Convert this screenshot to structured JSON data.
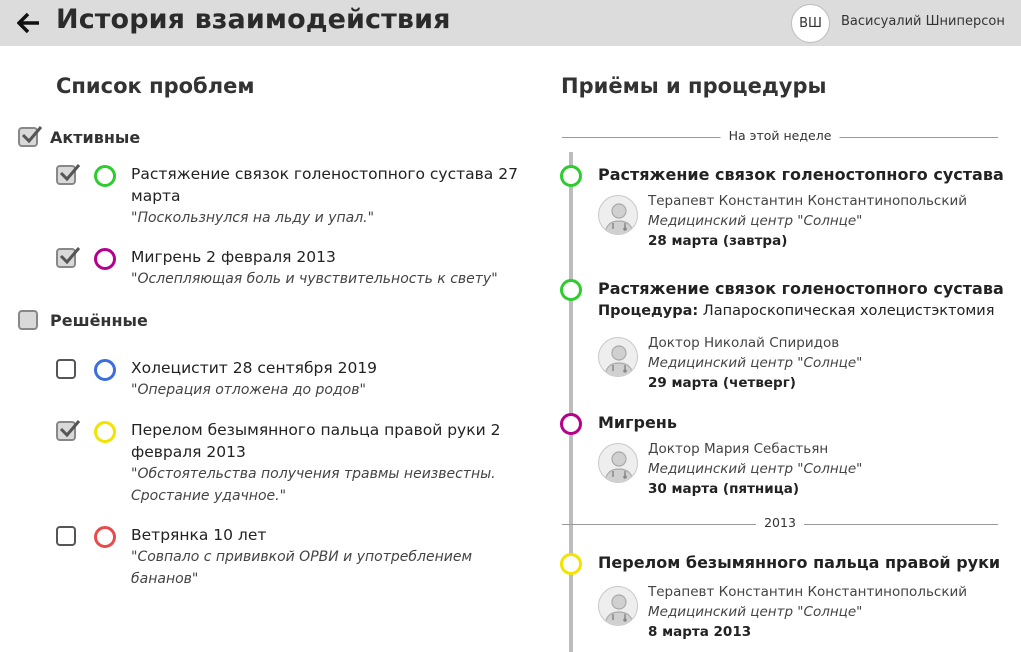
{
  "header": {
    "title": "История взаимодействия",
    "user_initials": "ВШ",
    "user_name": "Васисуалий Шниперсон"
  },
  "colors": {
    "header_bg": "#dcdcdc",
    "green": "#2ecc2e",
    "magenta": "#b5008c",
    "blue": "#3b6fe0",
    "yellow": "#f2e400",
    "red": "#e84b4b",
    "timeline": "#bdbdbd"
  },
  "problems": {
    "title": "Список проблем",
    "active": {
      "label": "Активные",
      "checked": true,
      "items": [
        {
          "name": "Растяжение связок голеностопного сустава 27 марта",
          "note": "\"Поскользнулся на льду и упал.\"",
          "checked": true,
          "color": "green"
        },
        {
          "name": "Мигрень 2 февраля 2013",
          "note": "\"Ослепляющая боль и чувствительность к свету\"",
          "checked": true,
          "color": "magenta"
        }
      ]
    },
    "resolved": {
      "label": "Решённые",
      "checked": false,
      "items": [
        {
          "name": "Холецистит 28 сентября 2019",
          "note": "\"Операция отложена до родов\"",
          "checked": false,
          "color": "blue"
        },
        {
          "name": "Перелом безымянного пальца правой руки 2 февраля 2013",
          "note": "\"Обстоятельства получения травмы неизвестны. Сростание удачное.\"",
          "checked": true,
          "color": "yellow"
        },
        {
          "name": "Ветрянка 10 лет",
          "note": "\"Совпало с прививкой ОРВИ и употреблением бананов\"",
          "checked": false,
          "color": "red"
        }
      ]
    }
  },
  "procedures": {
    "title": "Приёмы и процедуры",
    "separators": [
      "На этой неделе",
      "2013"
    ],
    "items": [
      {
        "title": "Растяжение связок голеностопного сустава",
        "color": "green",
        "procedure_label": "",
        "procedure_value": "",
        "doctor": "Терапевт Константин Константинопольский",
        "clinic": "Медицинский центр \"Солнце\"",
        "date": "28 марта (завтра)"
      },
      {
        "title": "Растяжение связок голеностопного сустава",
        "color": "green",
        "procedure_label": "Процедура:",
        "procedure_value": "Лапароскопическая холецистэктомия",
        "doctor": "Доктор Николай Спиридов",
        "clinic": "Медицинский центр \"Солнце\"",
        "date": "29 марта (четверг)"
      },
      {
        "title": "Мигрень",
        "color": "magenta",
        "procedure_label": "",
        "procedure_value": "",
        "doctor": "Доктор Мария Себастьян",
        "clinic": "Медицинский центр \"Солнце\"",
        "date": "30 марта (пятница)"
      },
      {
        "title": "Перелом безымянного пальца правой руки",
        "color": "yellow",
        "procedure_label": "",
        "procedure_value": "",
        "doctor": "Терапевт Константин Константинопольский",
        "clinic": "Медицинский центр \"Солнце\"",
        "date": "8 марта 2013"
      }
    ]
  }
}
